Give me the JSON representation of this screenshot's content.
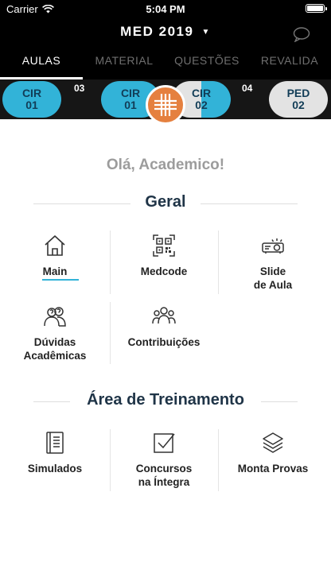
{
  "status": {
    "carrier": "Carrier",
    "time": "5:04 PM"
  },
  "header": {
    "course_title": "MED 2019",
    "caret": "▼"
  },
  "tabs": [
    {
      "label": "AULAS",
      "active": true
    },
    {
      "label": "MATERIAL",
      "active": false
    },
    {
      "label": "QUESTÕES",
      "active": false
    },
    {
      "label": "REVALIDA",
      "active": false
    }
  ],
  "carousel": {
    "pills": [
      {
        "line1": "CIR",
        "line2": "01"
      },
      {
        "line1": "CIR",
        "line2": "01"
      },
      {
        "line1": "CIR",
        "line2": "02"
      },
      {
        "line1": "PED",
        "line2": "02"
      }
    ],
    "numbers": [
      "03",
      "04"
    ]
  },
  "greeting": "Olá, Academico!",
  "sections": {
    "geral": {
      "title": "Geral",
      "items": [
        {
          "label": "Main",
          "icon": "home-icon"
        },
        {
          "label": "Medcode",
          "icon": "qr-code-icon"
        },
        {
          "label": "Slide\nde Aula",
          "icon": "projector-icon"
        },
        {
          "label": "Dúvidas\nAcadêmicas",
          "icon": "questions-icon"
        },
        {
          "label": "Contribuições",
          "icon": "people-group-icon"
        }
      ]
    },
    "treino": {
      "title": "Área de Treinamento",
      "items": [
        {
          "label": "Simulados",
          "icon": "document-list-icon"
        },
        {
          "label": "Concursos\nna Íntegra",
          "icon": "checkbox-icon"
        },
        {
          "label": "Monta Provas",
          "icon": "layers-icon"
        }
      ]
    }
  },
  "colors": {
    "accent": "#32b3d8",
    "logo": "#e5803f",
    "heading": "#1f3447",
    "greeting": "#9c9c9c"
  }
}
